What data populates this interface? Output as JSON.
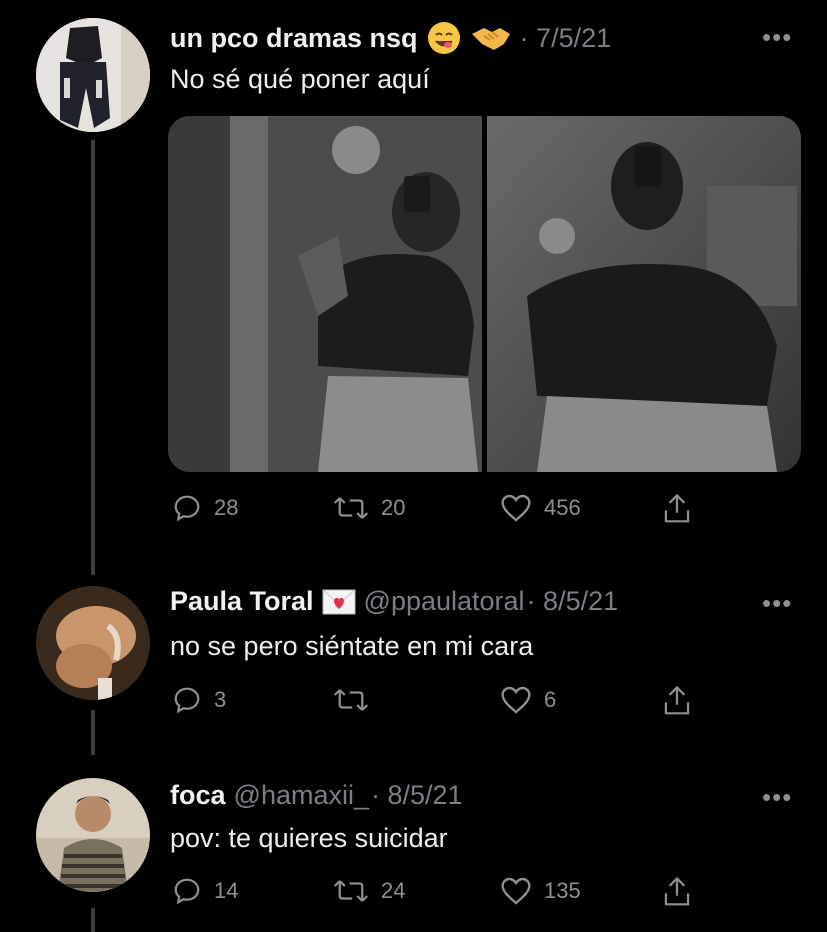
{
  "tweets": [
    {
      "name": "un pco dramas nsq",
      "handle": "",
      "date": "· 7/5/21",
      "text": "No sé qué poner aquí",
      "emojis": [
        "yum-face-emoji",
        "handshake-emoji"
      ],
      "replies": "28",
      "retweets": "20",
      "likes": "456"
    },
    {
      "name": "Paula Toral",
      "handle": "@ppaulatoral",
      "date": "· 8/5/21",
      "text": "no se pero siéntate en mi cara",
      "emojis": [
        "love-letter-emoji"
      ],
      "replies": "3",
      "retweets": "",
      "likes": "6"
    },
    {
      "name": "foca",
      "handle": "@hamaxii_",
      "date": "· 8/5/21",
      "text": "pov: te quieres suicidar",
      "emojis": [],
      "replies": "14",
      "retweets": "24",
      "likes": "135"
    }
  ],
  "more_label": "•••",
  "colors": {
    "background": "#000000",
    "text": "#e7e9ea",
    "muted": "#7a7f85",
    "thread_line": "#3a3d41"
  }
}
